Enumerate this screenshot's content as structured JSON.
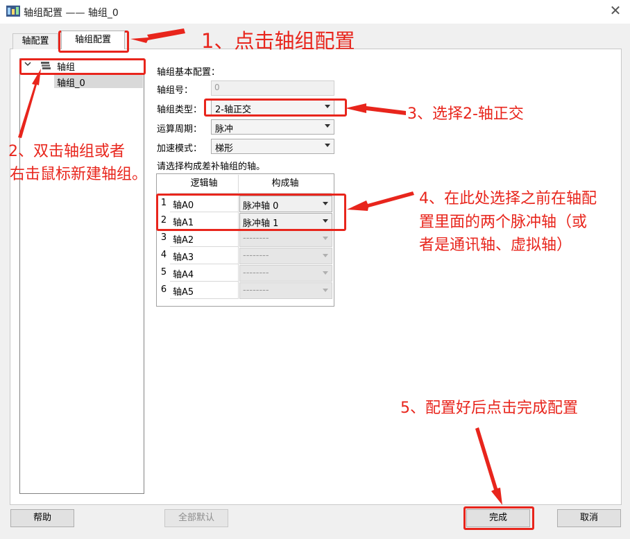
{
  "window": {
    "title": "轴组配置 —— 轴组_0",
    "close_label": "✕"
  },
  "tabs": [
    {
      "label": "轴配置"
    },
    {
      "label": "轴组配置"
    }
  ],
  "tree": {
    "root_label": "轴组",
    "child_label": "轴组_0"
  },
  "form": {
    "section_label": "轴组基本配置：",
    "group_number_label": "轴组号：",
    "group_number_value": "0",
    "group_type_label": "轴组类型：",
    "group_type_value": "2-轴正交",
    "cycle_label": "运算周期：",
    "cycle_value": "脉冲",
    "accel_label": "加速模式：",
    "accel_value": "梯形",
    "hint": "请选择构成差补轴组的轴。"
  },
  "grid": {
    "headers": [
      "逻辑轴",
      "构成轴"
    ],
    "rows": [
      {
        "num": "1",
        "logic": "轴A0",
        "axis": "脉冲轴  0"
      },
      {
        "num": "2",
        "logic": "轴A1",
        "axis": "脉冲轴  1"
      },
      {
        "num": "3",
        "logic": "轴A2",
        "axis": "--------"
      },
      {
        "num": "4",
        "logic": "轴A3",
        "axis": "--------"
      },
      {
        "num": "5",
        "logic": "轴A4",
        "axis": "--------"
      },
      {
        "num": "6",
        "logic": "轴A5",
        "axis": "--------"
      }
    ]
  },
  "buttons": {
    "help": "帮助",
    "reset_all": "全部默认",
    "finish": "完成",
    "cancel": "取消"
  },
  "annotations": {
    "step1": "1、点击轴组配置",
    "step2_line1": "2、双击轴组或者",
    "step2_line2": "右击鼠标新建轴组。",
    "step3": "3、选择2-轴正交",
    "step4_line1": "4、在此处选择之前在轴配",
    "step4_line2": "置里面的两个脉冲轴（或",
    "step4_line3": "者是通讯轴、虚拟轴）",
    "step5": "5、配置好后点击完成配置",
    "color": "#e8251c"
  }
}
